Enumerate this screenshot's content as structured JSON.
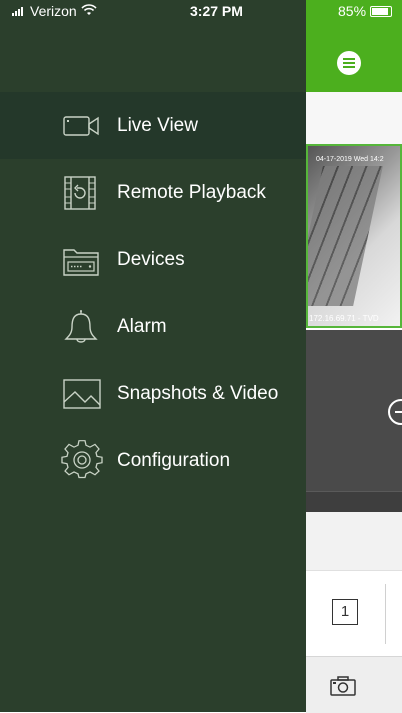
{
  "status_bar": {
    "carrier": "Verizon",
    "time": "3:27 PM",
    "battery": "85%"
  },
  "drawer": {
    "items": [
      {
        "label": "Live View",
        "icon": "video-camera-icon",
        "active": true
      },
      {
        "label": "Remote Playback",
        "icon": "playback-film-icon",
        "active": false
      },
      {
        "label": "Devices",
        "icon": "devices-icon",
        "active": false
      },
      {
        "label": "Alarm",
        "icon": "bell-icon",
        "active": false
      },
      {
        "label": "Snapshots & Video",
        "icon": "image-icon",
        "active": false
      },
      {
        "label": "Configuration",
        "icon": "gear-icon",
        "active": false
      }
    ]
  },
  "live_view": {
    "tile_timestamp": "04-17-2019 Wed 14:2",
    "tile_label": "172.16.69.71 - TVD",
    "layout_value": "1"
  },
  "colors": {
    "drawer_bg": "#2b3f2c",
    "accent_green": "#4caf1e"
  }
}
